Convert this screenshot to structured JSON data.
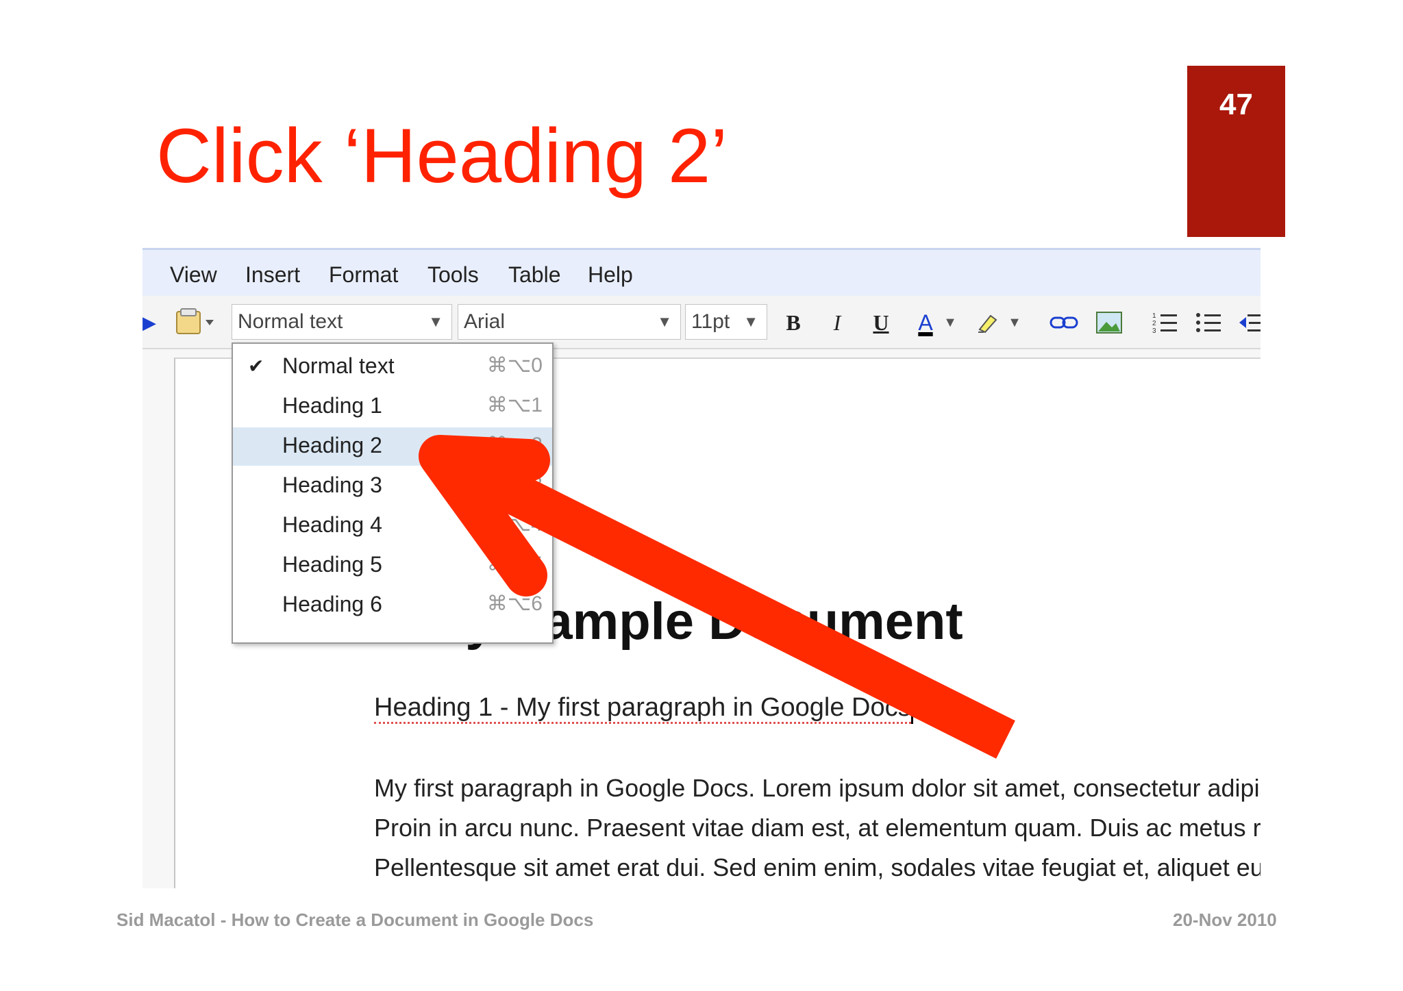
{
  "slide": {
    "title": "Click ‘Heading 2’",
    "page_number": "47"
  },
  "menu": {
    "items": [
      "View",
      "Insert",
      "Format",
      "Tools",
      "Table",
      "Help"
    ]
  },
  "toolbar": {
    "style_value": "Normal text",
    "font_value": "Arial",
    "size_value": "11pt",
    "bold_label": "B",
    "italic_label": "I",
    "underline_label": "U",
    "text_color_label": "A",
    "accent_color": "#1a3fd0"
  },
  "dropdown": {
    "items": [
      {
        "label": "Normal text",
        "shortcut": "⌘⌥0",
        "checked": "✔"
      },
      {
        "label": "Heading 1",
        "shortcut": "⌘⌥1"
      },
      {
        "label": "Heading 2",
        "shortcut": "⌘⌥2"
      },
      {
        "label": "Heading 3",
        "shortcut": "⌘⌥3"
      },
      {
        "label": "Heading 4",
        "shortcut": "⌘⌥4"
      },
      {
        "label": "Heading 5",
        "shortcut": "⌘⌥5"
      },
      {
        "label": "Heading 6",
        "shortcut": "⌘⌥6"
      }
    ],
    "highlighted": "Heading 2"
  },
  "document": {
    "title": "My Sample Document",
    "heading1": "Heading 1 - My first paragraph in Google Docs",
    "lines": [
      "My first paragraph in Google Docs. Lorem ipsum dolor sit amet, consectetur adipis",
      "Proin in arcu nunc. Praesent vitae diam est, at elementum quam. Duis ac metus ris",
      "Pellentesque sit amet erat dui. Sed enim enim, sodales vitae feugiat et, aliquet eu"
    ]
  },
  "footer": {
    "left": "Sid Macatol - How to Create a Document in Google Docs",
    "right": "20-Nov 2010"
  },
  "colors": {
    "title": "#ff2200",
    "page_box": "#a9180b",
    "arrow": "#ff2a00",
    "menu_bg": "#e8eefb"
  }
}
